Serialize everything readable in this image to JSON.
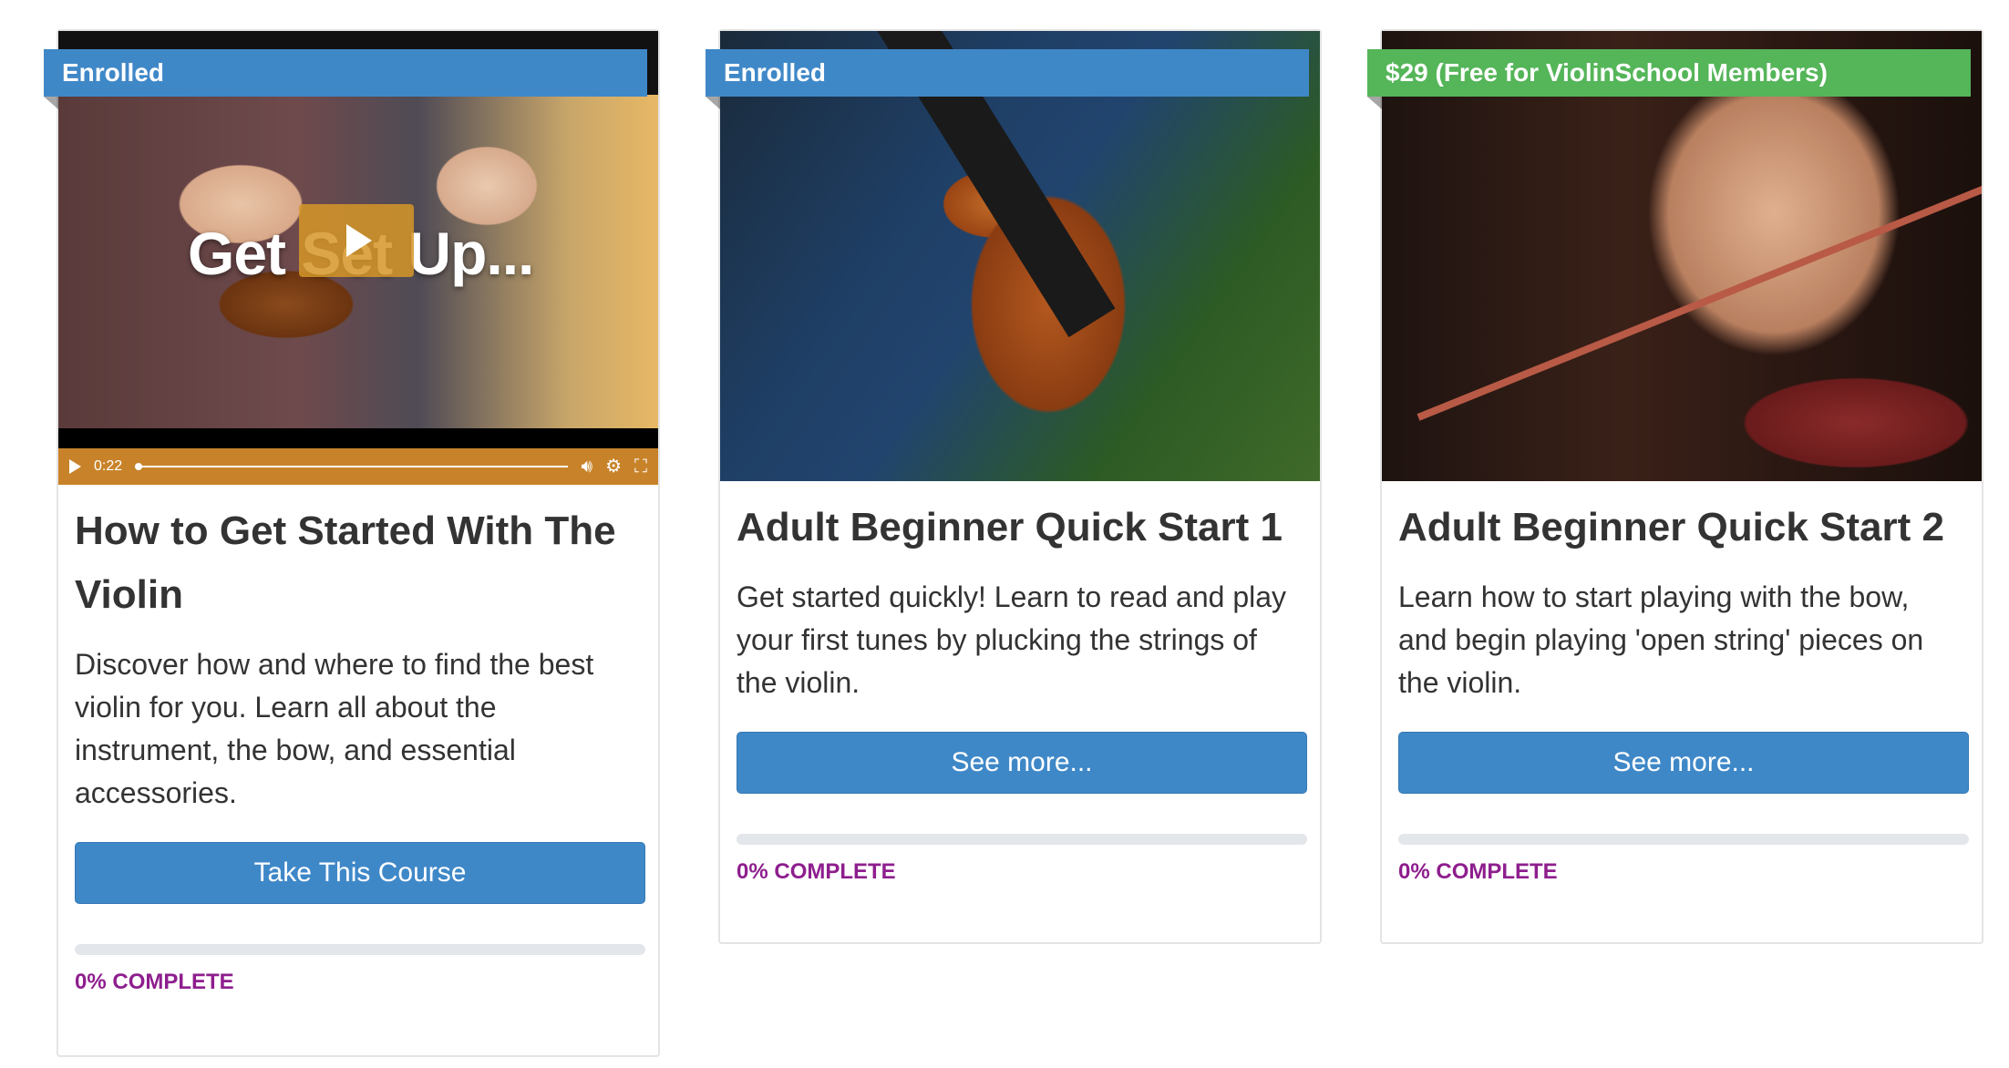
{
  "colors": {
    "accent_blue": "#3f88c8",
    "ribbon_green": "#55b559",
    "complete_purple": "#8e1e8e",
    "video_controls": "#c8832a"
  },
  "courses": [
    {
      "ribbon": "Enrolled",
      "ribbon_color": "blue",
      "media_type": "video",
      "video": {
        "overlay_text": "Get Set Up...",
        "time": "0:22",
        "icons": [
          "play-icon",
          "volume-icon",
          "settings-icon",
          "fullscreen-icon"
        ]
      },
      "title": "How to Get Started With The Violin",
      "description": "Discover how and where to find the best violin for you. Learn all about the instrument, the bow, and essential accessories.",
      "button": "Take This Course",
      "progress_fraction": 0,
      "progress_label": "0% COMPLETE"
    },
    {
      "ribbon": "Enrolled",
      "ribbon_color": "blue",
      "media_type": "image",
      "title": "Adult Beginner Quick Start 1",
      "description": "Get started quickly! Learn to read and play your first tunes by plucking the strings of the violin.",
      "button": "See more...",
      "progress_fraction": 0,
      "progress_label": "0% COMPLETE"
    },
    {
      "ribbon": "$29 (Free for ViolinSchool Members)",
      "ribbon_color": "green",
      "media_type": "image",
      "title": "Adult Beginner Quick Start 2",
      "description": "Learn how to start playing with the bow, and begin playing 'open string' pieces on the violin.",
      "button": "See more...",
      "progress_fraction": 0,
      "progress_label": "0% COMPLETE"
    }
  ]
}
